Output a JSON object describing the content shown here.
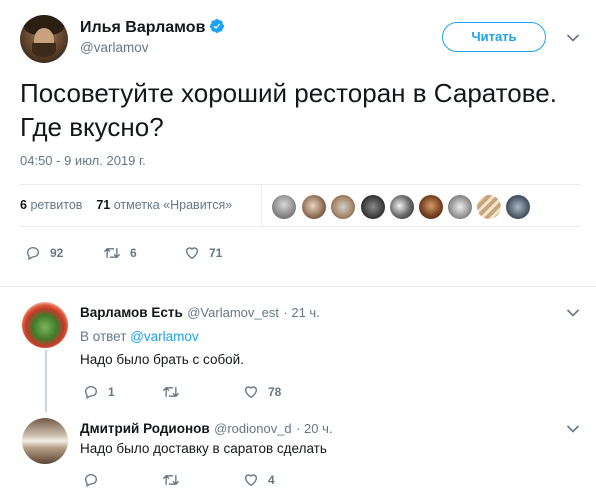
{
  "tweet": {
    "author_name": "Илья Варламов",
    "author_handle": "@varlamov",
    "follow_label": "Читать",
    "text": "Посоветуйте хороший ресторан в Саратове. Где вкусно?",
    "timestamp": "04:50 - 9 июл. 2019 г.",
    "retweets_count": "6",
    "retweets_label": "ретвитов",
    "likes_count": "71",
    "likes_label": "отметка «Нравится»",
    "actions": {
      "replies": "92",
      "retweets": "6",
      "likes": "71"
    }
  },
  "replies": [
    {
      "author_name": "Варламов Есть",
      "author_handle": "@Varlamov_est",
      "time": "· 21 ч.",
      "reply_to_prefix": "В ответ",
      "reply_to_handle": "@varlamov",
      "text": "Надо было брать с собой.",
      "actions": {
        "replies": "1",
        "retweets": "",
        "likes": "78"
      }
    },
    {
      "author_name": "Дмитрий Родионов",
      "author_handle": "@rodionov_d",
      "time": "· 20 ч.",
      "text": "Надо было доставку в саратов сделать",
      "actions": {
        "replies": "",
        "retweets": "",
        "likes": "4"
      }
    }
  ],
  "colors": {
    "accent": "#1da1f2",
    "secondary_text": "#657786",
    "divider": "#e6ecf0"
  },
  "icons": [
    "verified-badge-icon",
    "chevron-down-icon",
    "reply-icon",
    "retweet-icon",
    "like-icon"
  ]
}
